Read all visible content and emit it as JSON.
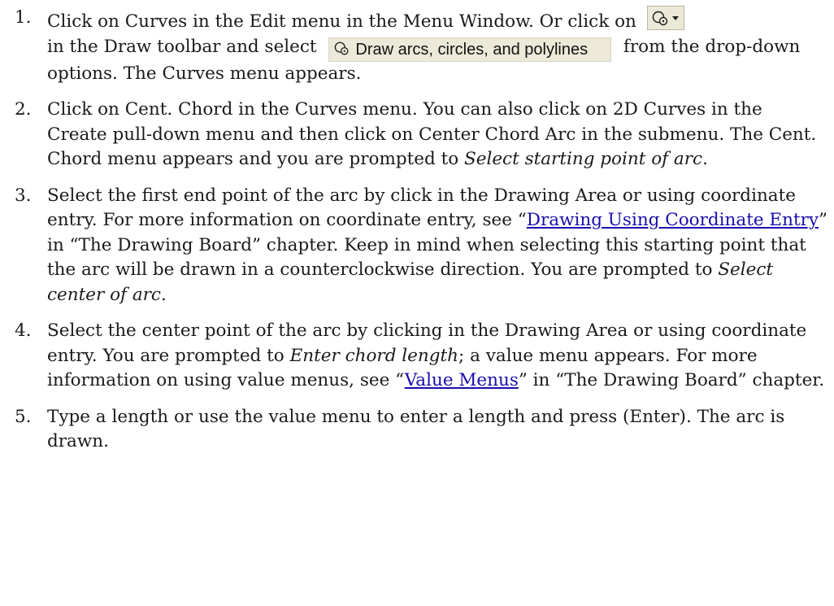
{
  "steps": [
    {
      "num": "1.",
      "a": "Click on Curves in the Edit menu in the Menu Window. Or click on",
      "b": "in the Draw toolbar and select",
      "option_label": "Draw arcs, circles, and polylines",
      "c": "from the drop-down options. The Curves menu appears."
    },
    {
      "num": "2.",
      "a": "Click on Cent. Chord in the Curves menu. You can also click on 2D Curves in the Create pull-down menu and then click on Center Chord Arc in the submenu. The Cent. Chord menu appears and you are prompted to",
      "em": "Select starting point of arc",
      "b": "."
    },
    {
      "num": "3.",
      "a": "Select the first end point of the arc by click in the Drawing Area or using coordinate entry. For more information on coordinate entry, see “",
      "link": "Drawing Using Coordinate Entry",
      "b": "” in “The Drawing Board” chapter. Keep in mind when selecting this starting point that the arc will be drawn in a counterclockwise direction. You are prompted to",
      "em": "Select center of arc",
      "c": "."
    },
    {
      "num": "4.",
      "a": "Select the center point of the arc by clicking in the Drawing Area or using coordinate entry. You are prompted to",
      "em": "Enter chord length",
      "b": "; a value menu appears. For more information on using value menus, see “",
      "link": "Value Menus",
      "c": "” in “The Drawing Board” chapter."
    },
    {
      "num": "5.",
      "a": "Type a length or use the value menu to enter a length and press (Enter). The arc is drawn."
    }
  ],
  "icons": {
    "toolbar_button": "arc-circle-polyline-dropdown-icon",
    "option_icon": "arc-circle-icon"
  },
  "colors": {
    "link": "#1a0dab",
    "toolbar_bg": "#ece9d8"
  }
}
